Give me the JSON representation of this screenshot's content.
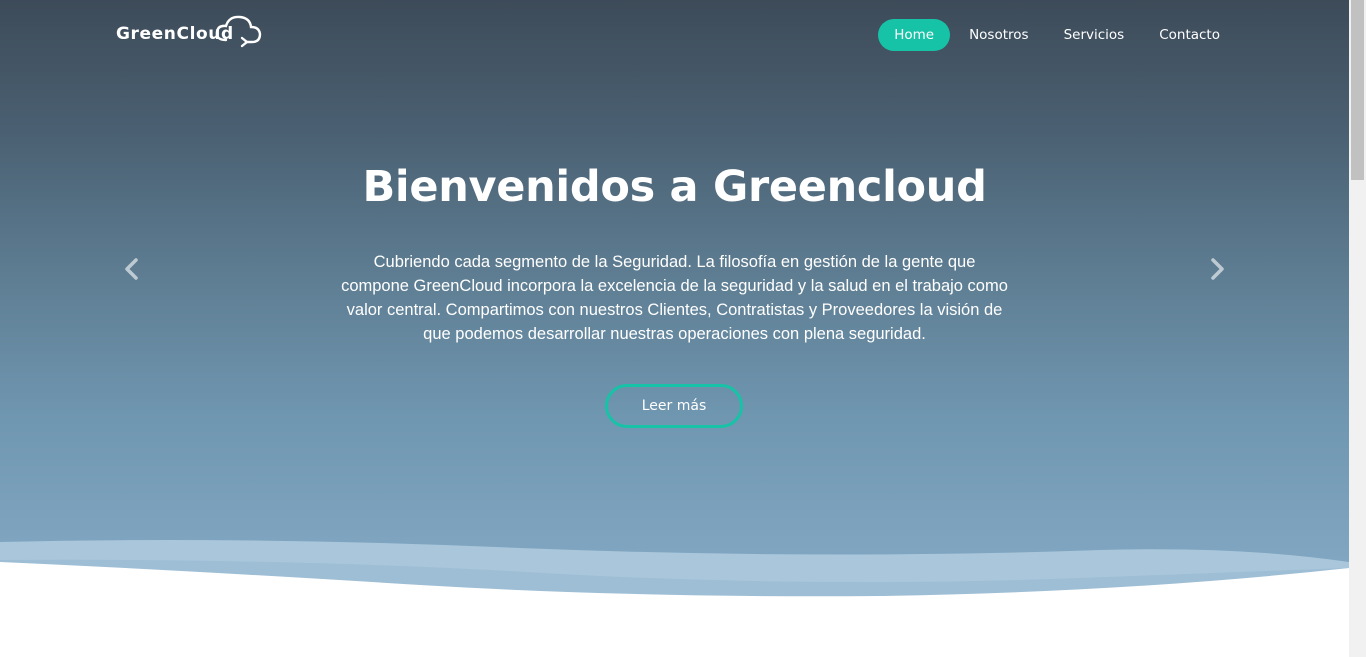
{
  "brand": {
    "name": "GreenCloud"
  },
  "nav": {
    "items": [
      {
        "label": "Home",
        "active": true
      },
      {
        "label": "Nosotros",
        "active": false
      },
      {
        "label": "Servicios",
        "active": false
      },
      {
        "label": "Contacto",
        "active": false
      }
    ]
  },
  "hero": {
    "title": "Bienvenidos a Greencloud",
    "description": "Cubriendo cada segmento de la Seguridad. La filosofía en gestión de la gente que compone GreenCloud incorpora la excelencia de la seguridad y la salud en el trabajo como valor central. Compartimos con nuestros Clientes, Contratistas y Proveedores la visión de que podemos desarrollar nuestras operaciones con plena seguridad.",
    "cta_label": "Leer más"
  },
  "carousel": {
    "prev_icon": "chevron-left-icon",
    "next_icon": "chevron-right-icon"
  },
  "colors": {
    "accent": "#16c3a6",
    "hero_top": "#3d4b59",
    "hero_bottom": "#85aac6"
  }
}
